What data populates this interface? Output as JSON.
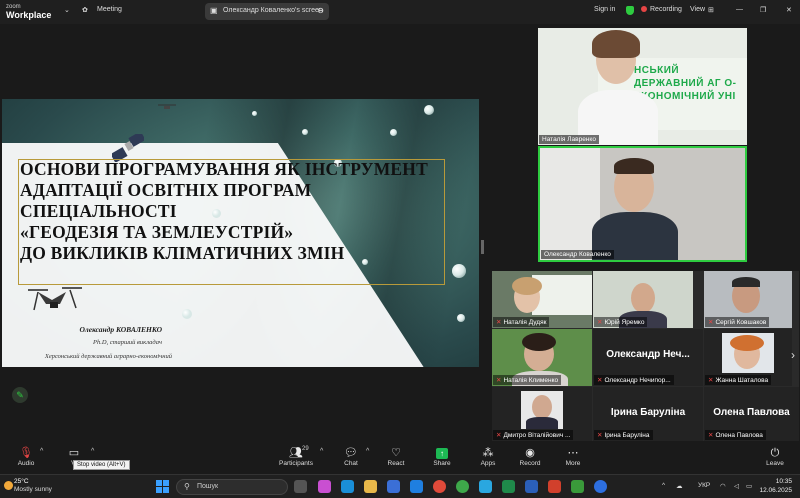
{
  "titlebar": {
    "brand_line1": "zoom",
    "brand_line2": "Workplace",
    "meeting_label": "Meeting",
    "share_label": "Олександр Коваленко's screen",
    "signin": "Sign in",
    "recording": "Recording",
    "view": "View"
  },
  "slide": {
    "title_lines": [
      "ОСНОВИ ПРОГРАМУВАННЯ ЯК ІНСТРУМЕНТ",
      "АДАПТАЦІЇ ОСВІТНІХ ПРОГРАМ",
      "СПЕЦІАЛЬНОСТІ",
      "«ГЕОДЕЗІЯ ТА ЗЕМЛЕУСТРІЙ»",
      "ДО ВИКЛИКІВ КЛІМАТИЧНИХ ЗМІН"
    ],
    "author": "Олександр КОВАЛЕНКО",
    "degree": "Ph.D, старший викладач",
    "university": "Херсонський державний аграрно-економічний"
  },
  "speakers": {
    "top": {
      "name": "Наталія Лавренко",
      "banner": "НСЬКИЙ ДЕРЖАВНИЙ АГ      О-ЕКОНОМІЧНИЙ УНІ       ТЕТ"
    },
    "active": {
      "name": "Олександр Коваленко"
    }
  },
  "gallery": [
    {
      "name": "Наталія Дудяк",
      "muted": true,
      "type": "video"
    },
    {
      "name": "Юрій Яремко",
      "muted": true,
      "type": "video"
    },
    {
      "name": "Сергій Ковшаков",
      "muted": true,
      "type": "video"
    },
    {
      "name": "Наталія Клименко",
      "muted": true,
      "type": "video"
    },
    {
      "name": "Олександр Нечипор...",
      "big": "Олександр  Неч...",
      "muted": true,
      "type": "text"
    },
    {
      "name": "Жанна Шаталова",
      "muted": true,
      "type": "video"
    },
    {
      "name": "Дмитро Віталійович ...",
      "muted": true,
      "type": "video"
    },
    {
      "name": "Ірина Баруліна",
      "big": "Ірина Баруліна",
      "muted": true,
      "type": "text"
    },
    {
      "name": "Олена Павлова",
      "big": "Олена Павлова",
      "muted": true,
      "type": "text"
    }
  ],
  "toolbar": {
    "audio": "Audio",
    "video": "Vi",
    "video_tooltip": "Stop video (Alt+V)",
    "participants": "Participants",
    "participants_count": "29",
    "chat": "Chat",
    "react": "React",
    "share": "Share",
    "apps": "Apps",
    "record": "Record",
    "more": "More",
    "leave": "Leave"
  },
  "taskbar": {
    "temp": "25°C",
    "weather": "Mostly sunny",
    "search_placeholder": "Пошук",
    "lang": "УКР",
    "time": "10:35",
    "date": "12.06.2025"
  },
  "colors": {
    "accent_green": "#2ecc40",
    "record_red": "#e64545"
  }
}
